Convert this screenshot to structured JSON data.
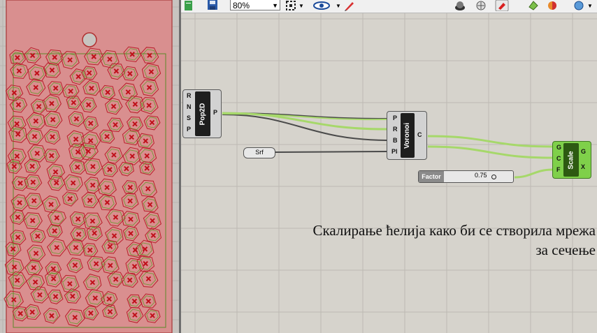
{
  "toolbar": {
    "zoom_value": "80%"
  },
  "components": {
    "pop2d": {
      "title": "Pop2D",
      "inputs": [
        "R",
        "N",
        "S",
        "P"
      ],
      "outputs": [
        "P"
      ]
    },
    "srf": {
      "label": "Srf"
    },
    "voronoi": {
      "title": "Voronoi",
      "inputs": [
        "P",
        "R",
        "B",
        "Pl"
      ],
      "outputs": [
        "C"
      ]
    },
    "scale": {
      "title": "Scale",
      "inputs": [
        "G",
        "C",
        "F"
      ],
      "outputs": [
        "G",
        "X"
      ]
    },
    "factor": {
      "label": "Factor",
      "value": "0.75"
    }
  },
  "caption": {
    "line1": "Скалирање ћелија како би се створила мрежа",
    "line2": "за сечење"
  },
  "colors": {
    "panel": "#d98f8f",
    "wire_green": "#a6d86a",
    "component_green": "#7fd04a"
  }
}
